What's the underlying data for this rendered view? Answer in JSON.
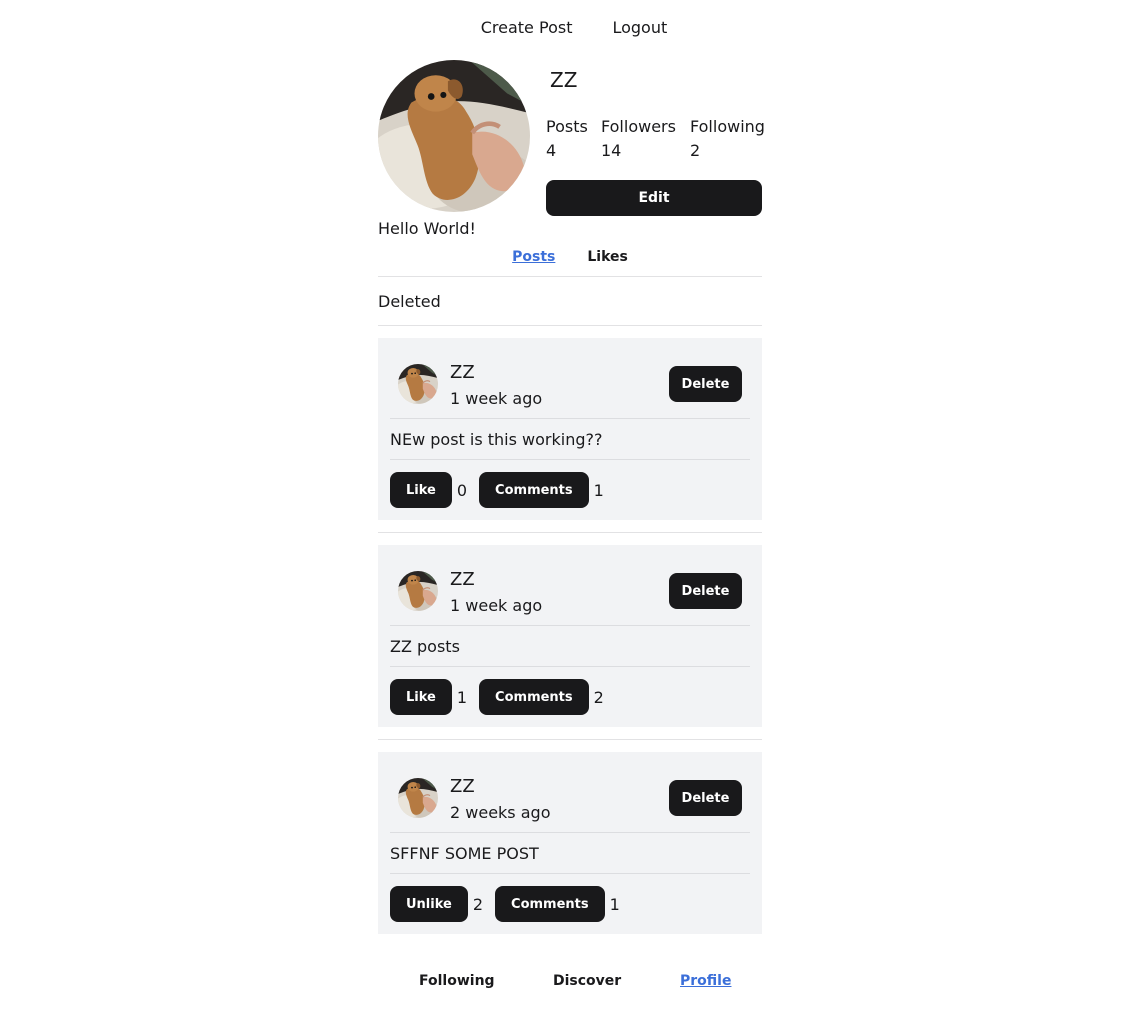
{
  "nav": {
    "create_post": "Create Post",
    "logout": "Logout"
  },
  "profile": {
    "username": "ZZ",
    "stats": [
      {
        "label": "Posts",
        "value": "4"
      },
      {
        "label": "Followers",
        "value": "14"
      },
      {
        "label": "Following",
        "value": "2"
      }
    ],
    "edit_label": "Edit",
    "bio": "Hello World!",
    "avatar_icon": "dog-photo-avatar"
  },
  "tabs": {
    "posts": "Posts",
    "likes": "Likes",
    "active": "Posts"
  },
  "deleted_label": "Deleted",
  "posts": [
    {
      "author": "ZZ",
      "time": "1 week ago",
      "body": "NEw post is this working??",
      "delete_label": "Delete",
      "like_label": "Like",
      "like_count": "0",
      "comments_label": "Comments",
      "comment_count": "1"
    },
    {
      "author": "ZZ",
      "time": "1 week ago",
      "body": "ZZ posts",
      "delete_label": "Delete",
      "like_label": "Like",
      "like_count": "1",
      "comments_label": "Comments",
      "comment_count": "2"
    },
    {
      "author": "ZZ",
      "time": "2 weeks ago",
      "body": "SFFNF SOME POST",
      "delete_label": "Delete",
      "like_label": "Unlike",
      "like_count": "2",
      "comments_label": "Comments",
      "comment_count": "1"
    }
  ],
  "bottom_nav": {
    "following": "Following",
    "discover": "Discover",
    "profile": "Profile",
    "active": "Profile"
  },
  "colors": {
    "accent": "#3b6fd9",
    "button": "#19191b",
    "card_bg": "#f2f3f5"
  }
}
